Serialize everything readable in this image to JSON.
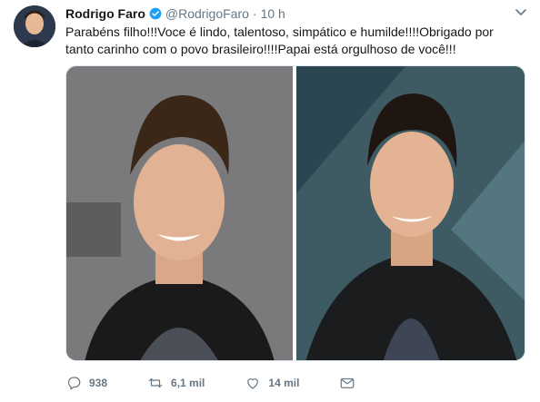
{
  "tweet": {
    "author_name": "Rodrigo Faro",
    "author_handle": "@RodrigoFaro",
    "separator": "·",
    "time": "10 h",
    "text": "Parabéns filho!!!Voce é lindo, talentoso, simpático e humilde!!!!Obrigado por tanto carinho com o povo brasileiro!!!!Papai está orgulhoso de você!!!",
    "replies": "938",
    "retweets": "6,1 mil",
    "likes": "14 mil"
  },
  "icons": {
    "verified": "verified-badge-icon",
    "caret": "chevron-down-icon",
    "reply": "reply-icon",
    "retweet": "retweet-icon",
    "like": "heart-icon",
    "dm": "envelope-icon"
  },
  "colors": {
    "text": "#14171a",
    "muted": "#657786",
    "verified": "#1da1f2"
  }
}
